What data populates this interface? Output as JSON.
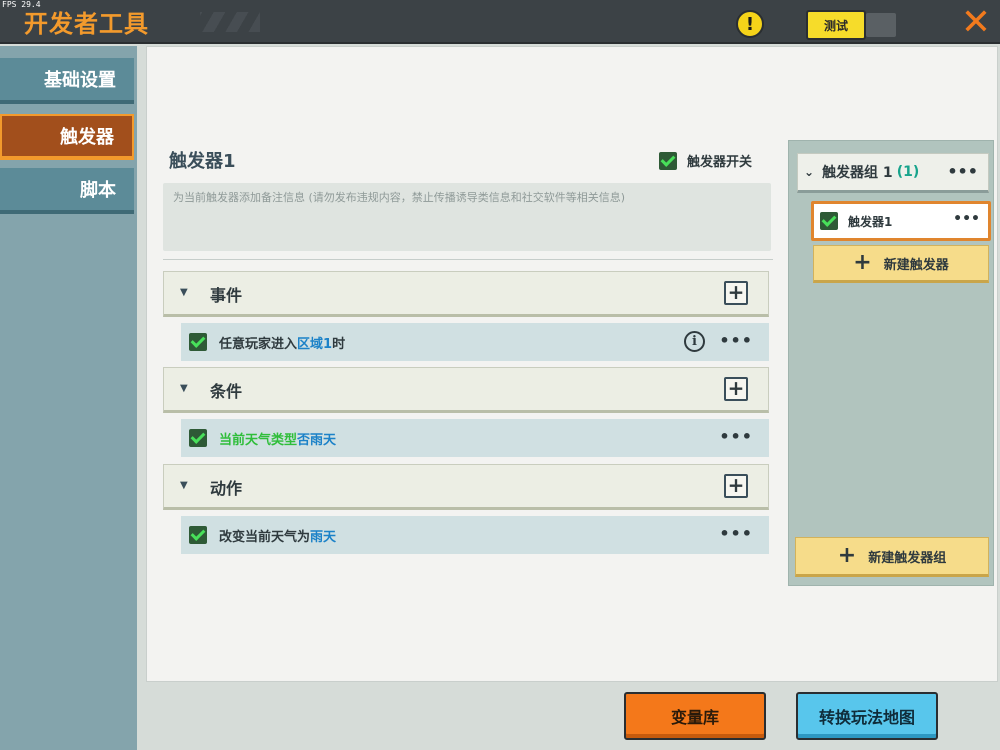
{
  "top": {
    "fps": "FPS 29.4",
    "title": "开发者工具",
    "test_label": "测试",
    "warning_glyph": "!",
    "close_glyph": "✕"
  },
  "nav": {
    "items": [
      {
        "label": "基础设置",
        "active": false
      },
      {
        "label": "触发器",
        "active": true
      },
      {
        "label": "脚本",
        "active": false
      }
    ]
  },
  "trigger": {
    "title": "触发器1",
    "switch_label": "触发器开关",
    "notes_placeholder": "为当前触发器添加备注信息 (请勿发布违规内容，禁止传播诱导类信息和社交软件等相关信息)"
  },
  "sections": {
    "event": {
      "label": "事件",
      "row": {
        "text_a": "任意玩家进入",
        "text_b": "区域1",
        "text_c": "时"
      }
    },
    "condition": {
      "label": "条件",
      "row": {
        "text_a": "当前天气类型",
        "text_b": "否",
        "text_c": "雨天"
      }
    },
    "action": {
      "label": "动作",
      "row": {
        "text_a": "改变当前天气为",
        "text_b": "雨天"
      }
    }
  },
  "group": {
    "label": "触发器组 1",
    "count": "(1)",
    "trigger_item": "触发器1",
    "new_trigger": "新建触发器",
    "new_group": "新建触发器组"
  },
  "bottom": {
    "variables": "变量库",
    "convert_map": "转换玩法地图"
  },
  "common": {
    "more": "•••",
    "plus": "+",
    "collapse_tri": "▼",
    "chevron": "⌄",
    "info": "i"
  },
  "colors": {
    "accent_orange": "#f39a2c",
    "link_blue": "#1c82c8",
    "condition_green": "#2fbe3a",
    "count_teal": "#18a48c"
  }
}
